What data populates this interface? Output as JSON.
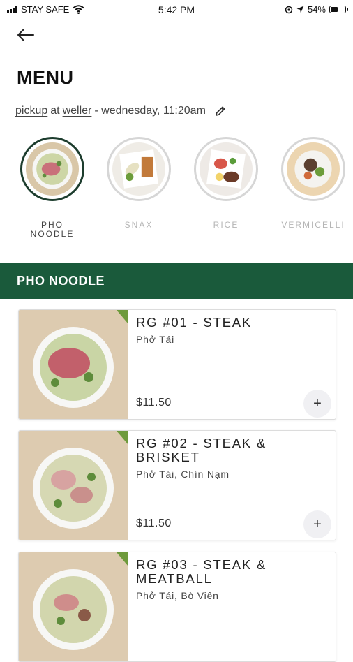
{
  "status_bar": {
    "carrier": "STAY SAFE",
    "time": "5:42 PM",
    "battery_percent": "54%",
    "battery_level": 0.54
  },
  "header": {
    "back_icon": "arrow-left-icon",
    "title": "MENU"
  },
  "pickup": {
    "mode": "pickup",
    "at": "at",
    "location": "weller",
    "datetime": "- wednesday, 11:20am",
    "edit_icon": "pencil-icon"
  },
  "categories": [
    {
      "line1": "PHO",
      "line2": "NOODLE",
      "active": true
    },
    {
      "line1": "SNAX",
      "line2": "",
      "active": false
    },
    {
      "line1": "RICE",
      "line2": "",
      "active": false
    },
    {
      "line1": "VERMICELLI",
      "line2": "",
      "active": false
    }
  ],
  "section": {
    "title": "PHO NOODLE"
  },
  "items": [
    {
      "name": "RG #01 - STEAK",
      "subtitle": "Phở Tái",
      "price": "$11.50"
    },
    {
      "name": "RG #02 - STEAK & BRISKET",
      "subtitle": "Phở Tái, Chín Nạm",
      "price": "$11.50"
    },
    {
      "name": "RG #03 - STEAK & MEATBALL",
      "subtitle": "Phở Tái, Bò Viên",
      "price": ""
    }
  ],
  "add_label": "+",
  "colors": {
    "brand_green": "#1a5a3b",
    "active_ring": "#1d3d2e"
  }
}
